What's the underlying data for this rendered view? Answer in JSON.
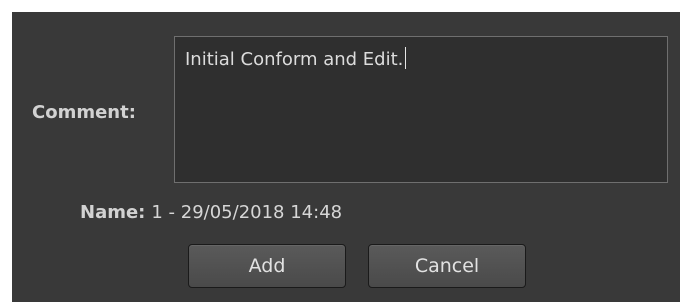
{
  "form": {
    "comment_label": "Comment:",
    "comment_value": "Initial Conform and Edit.",
    "name_label": "Name:",
    "name_value": "1 - 29/05/2018 14:48"
  },
  "buttons": {
    "add_label": "Add",
    "cancel_label": "Cancel"
  },
  "colors": {
    "dialog_background": "#393939",
    "textarea_background": "#2f2f2f",
    "button_background": "#505050",
    "text": "#d6d6d6"
  }
}
